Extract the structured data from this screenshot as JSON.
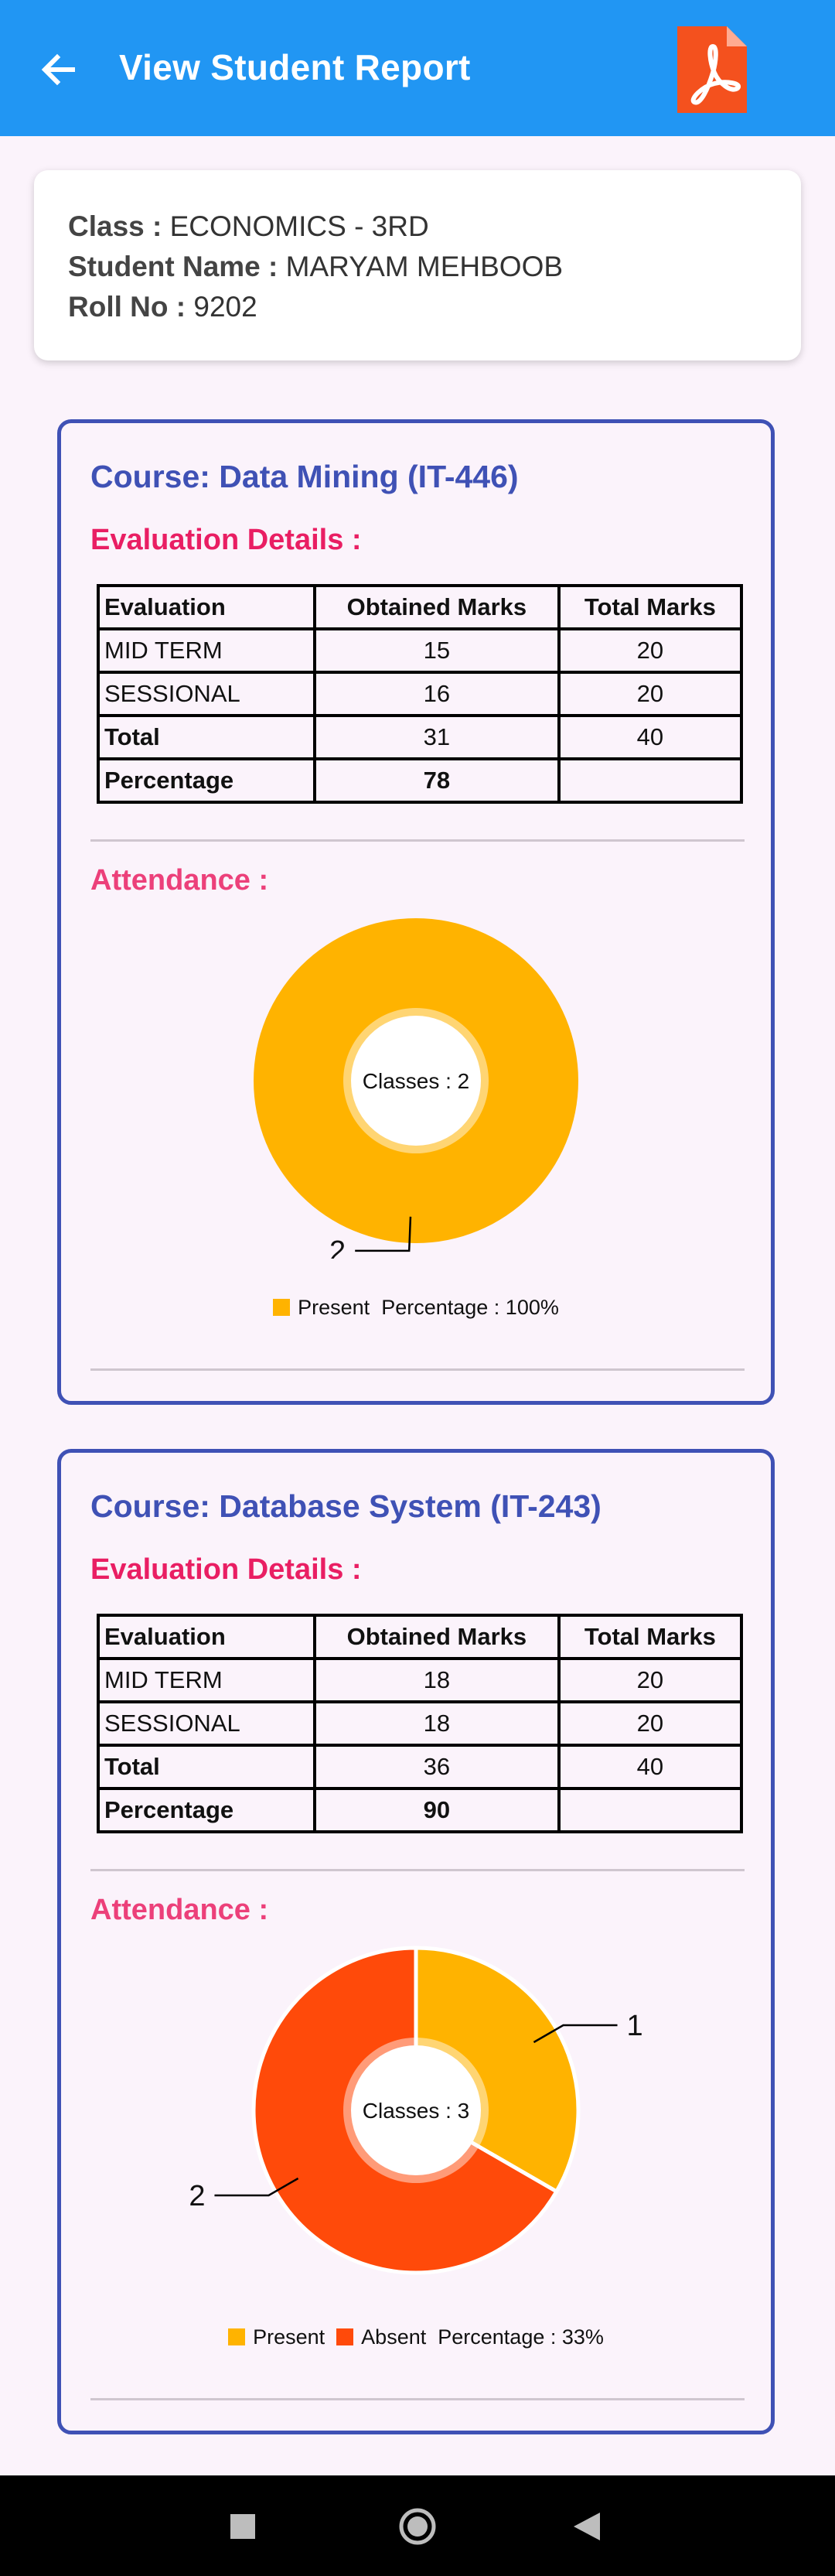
{
  "appbar": {
    "title": "View Student Report",
    "back_icon": "arrow-left-icon",
    "pdf_icon": "pdf-icon",
    "color": "#2196f3"
  },
  "student": {
    "class_label": "Class :",
    "class_value": "ECONOMICS - 3RD",
    "name_label": "Student Name :",
    "name_value": "MARYAM MEHBOOB",
    "roll_label": "Roll No :",
    "roll_value": "9202"
  },
  "table_headers": [
    "Evaluation",
    "Obtained Marks",
    "Total Marks"
  ],
  "eval_heading": "Evaluation Details :",
  "attendance_heading": "Attendance :",
  "courses": [
    {
      "title": "Course: Data Mining (IT-446)",
      "rows": [
        {
          "evaluation": "MID TERM",
          "obtained": "15",
          "total": "20"
        },
        {
          "evaluation": "SESSIONAL",
          "obtained": "16",
          "total": "20"
        },
        {
          "evaluation": "Total",
          "obtained": "31",
          "total": "40"
        },
        {
          "evaluation": "Percentage",
          "obtained": "78",
          "total": ""
        }
      ],
      "center_text": "Classes : 2",
      "percentage_text": "Percentage : 100%"
    },
    {
      "title": "Course: Database System (IT-243)",
      "rows": [
        {
          "evaluation": "MID TERM",
          "obtained": "18",
          "total": "20"
        },
        {
          "evaluation": "SESSIONAL",
          "obtained": "18",
          "total": "20"
        },
        {
          "evaluation": "Total",
          "obtained": "36",
          "total": "40"
        },
        {
          "evaluation": "Percentage",
          "obtained": "90",
          "total": ""
        }
      ],
      "center_text": "Classes : 3",
      "percentage_text": "Percentage : 33%"
    }
  ],
  "chart_data": [
    {
      "type": "pie",
      "categories": [
        "Present"
      ],
      "values": [
        2
      ],
      "colors": [
        "#ffb300"
      ],
      "donut": true,
      "center_label": "Classes : 2",
      "legend": [
        "Present"
      ],
      "legend_note": "Percentage : 100%"
    },
    {
      "type": "pie",
      "categories": [
        "Present",
        "Absent"
      ],
      "values": [
        1,
        2
      ],
      "colors": [
        "#ffb300",
        "#ff4a0a"
      ],
      "donut": true,
      "center_label": "Classes : 3",
      "legend": [
        "Present",
        "Absent"
      ],
      "legend_note": "Percentage : 33%"
    }
  ],
  "navbar": {
    "recents_icon": "square-icon",
    "home_icon": "circle-icon",
    "back_icon": "triangle-back-icon"
  }
}
